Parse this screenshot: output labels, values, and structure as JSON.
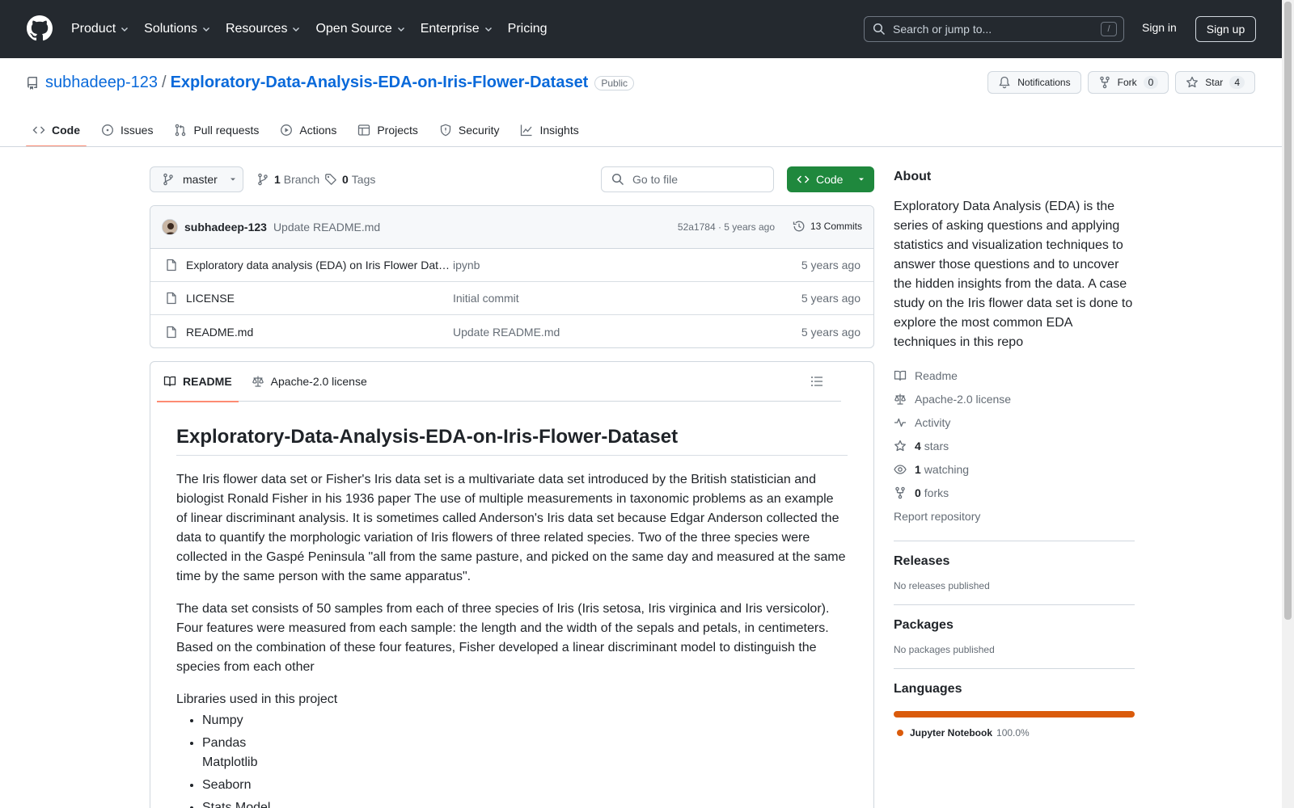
{
  "header": {
    "nav": [
      "Product",
      "Solutions",
      "Resources",
      "Open Source",
      "Enterprise",
      "Pricing"
    ],
    "search_placeholder": "Search or jump to...",
    "search_key": "/",
    "sign_in": "Sign in",
    "sign_up": "Sign up"
  },
  "repo": {
    "owner": "subhadeep-123",
    "separator": "/",
    "name": "Exploratory-Data-Analysis-EDA-on-Iris-Flower-Dataset",
    "visibility": "Public",
    "notifications": "Notifications",
    "fork_label": "Fork",
    "fork_count": "0",
    "star_label": "Star",
    "star_count": "4"
  },
  "tabs": [
    "Code",
    "Issues",
    "Pull requests",
    "Actions",
    "Projects",
    "Security",
    "Insights"
  ],
  "filenav": {
    "branch": "master",
    "branch_count": "1",
    "branch_label": "Branch",
    "tag_count": "0",
    "tag_label": "Tags",
    "goto_placeholder": "Go to file",
    "code_button": "Code"
  },
  "commit": {
    "author": "subhadeep-123",
    "message": "Update README.md",
    "meta": "52a1784 · 5 years ago",
    "commits": "13 Commits"
  },
  "files": [
    {
      "name": "Exploratory data analysis (EDA) on Iris Flower Dataset.ipynb",
      "commit": "ipynb",
      "time": "5 years ago"
    },
    {
      "name": "LICENSE",
      "commit": "Initial commit",
      "time": "5 years ago"
    },
    {
      "name": "README.md",
      "commit": "Update README.md",
      "time": "5 years ago"
    }
  ],
  "readme": {
    "tab_readme": "README",
    "tab_license": "Apache-2.0 license",
    "title": "Exploratory-Data-Analysis-EDA-on-Iris-Flower-Dataset",
    "p1": "The Iris flower data set or Fisher's Iris data set is a multivariate data set introduced by the British statistician and biologist Ronald Fisher in his 1936 paper The use of multiple measurements in taxonomic problems as an example of linear discriminant analysis. It is sometimes called Anderson's Iris data set because Edgar Anderson collected the data to quantify the morphologic variation of Iris flowers of three related species. Two of the three species were collected in the Gaspé Peninsula \"all from the same pasture, and picked on the same day and measured at the same time by the same person with the same apparatus\".",
    "p2": "The data set consists of 50 samples from each of three species of Iris (Iris setosa, Iris virginica and Iris versicolor). Four features were measured from each sample: the length and the width of the sepals and petals, in centimeters. Based on the combination of these four features, Fisher developed a linear discriminant model to distinguish the species from each other",
    "libs_intro": "Libraries used in this project",
    "lib1": "Numpy",
    "lib2": "Pandas",
    "lib2b": "Matplotlib",
    "lib3": "Seaborn",
    "lib4": "Stats Model"
  },
  "about": {
    "heading": "About",
    "description": "Exploratory Data Analysis (EDA) is the series of asking questions and applying statistics and visualization techniques to answer those questions and to uncover the hidden insights from the data. A case study on the Iris flower data set is done to explore the most common EDA techniques in this repo",
    "readme": "Readme",
    "license": "Apache-2.0 license",
    "activity": "Activity",
    "stars_count": "4",
    "stars_label": "stars",
    "watching_count": "1",
    "watching_label": "watching",
    "forks_count": "0",
    "forks_label": "forks",
    "report": "Report repository"
  },
  "releases": {
    "heading": "Releases",
    "text": "No releases published"
  },
  "packages": {
    "heading": "Packages",
    "text": "No packages published"
  },
  "languages": {
    "heading": "Languages",
    "name": "Jupyter Notebook",
    "percent": "100.0%",
    "color": "#DA5B0B"
  },
  "colors": {
    "header_bg": "#24292f",
    "link": "#0969da",
    "code_btn": "#1f883d",
    "tab_underline": "#fd8c73"
  }
}
